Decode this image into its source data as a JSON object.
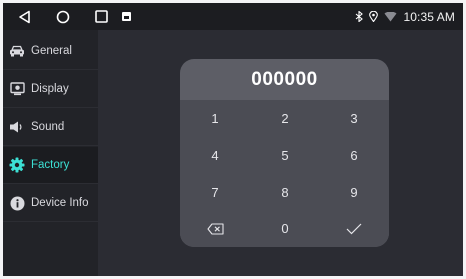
{
  "status_bar": {
    "time": "10:35 AM",
    "icons": [
      "back-icon",
      "home-icon",
      "recent-apps-icon",
      "notification-icon",
      "bluetooth-icon",
      "location-icon",
      "wifi-icon"
    ]
  },
  "sidebar": {
    "items": [
      {
        "label": "General",
        "icon": "car-icon",
        "active": false
      },
      {
        "label": "Display",
        "icon": "display-icon",
        "active": false
      },
      {
        "label": "Sound",
        "icon": "speaker-icon",
        "active": false
      },
      {
        "label": "Factory",
        "icon": "gear-icon",
        "active": true
      },
      {
        "label": "Device Info",
        "icon": "info-icon",
        "active": false
      }
    ]
  },
  "keypad": {
    "entered_code": "000000",
    "keys": [
      "1",
      "2",
      "3",
      "4",
      "5",
      "6",
      "7",
      "8",
      "9",
      "0"
    ],
    "backspace_icon": "backspace-icon",
    "confirm_icon": "check-icon"
  },
  "colors": {
    "accent": "#3ce0d4",
    "background": "#2b2c33",
    "sidebar": "#222328",
    "panel": "#5d5e66",
    "keypad": "#4b4c54"
  }
}
